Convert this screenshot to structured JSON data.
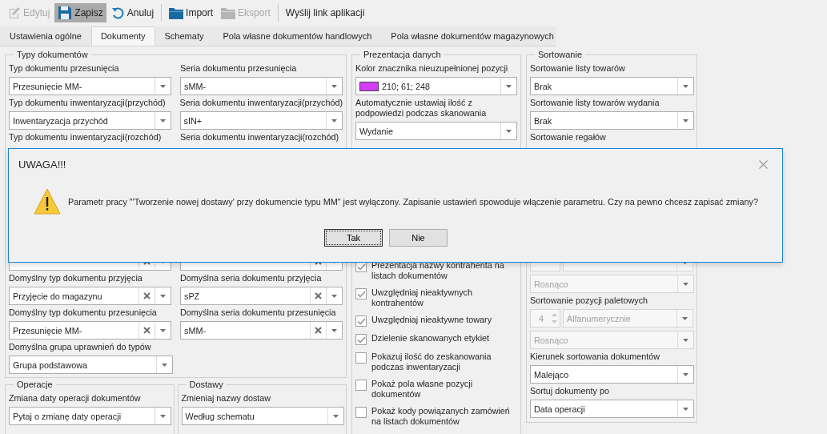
{
  "toolbar": [
    {
      "kind": "button",
      "label": "Edytuj",
      "disabled": true,
      "pressed": false
    },
    {
      "kind": "button",
      "label": "Zapisz",
      "disabled": false,
      "pressed": true
    },
    {
      "kind": "button",
      "label": "Anuluj",
      "disabled": false,
      "pressed": false
    },
    {
      "kind": "separator"
    },
    {
      "kind": "button",
      "label": "Import",
      "disabled": false,
      "pressed": false
    },
    {
      "kind": "button",
      "label": "Eksport",
      "disabled": true,
      "pressed": false
    },
    {
      "kind": "separator"
    },
    {
      "kind": "button",
      "label": "Wyślij link aplikacji",
      "disabled": false,
      "pressed": false
    }
  ],
  "tabs": [
    {
      "label": "Ustawienia ogólne",
      "selected": false
    },
    {
      "label": "Dokumenty",
      "selected": true
    },
    {
      "label": "Schematy",
      "selected": false
    },
    {
      "label": "Pola własne dokumentów handlowych",
      "selected": false
    },
    {
      "label": "Pola własne dokumentów magazynowych",
      "selected": false
    }
  ],
  "document_types": {
    "title": "Typy dokumentów",
    "rows_top": [
      [
        {
          "label": "Typ dokumentu przesunięcia",
          "value": "Przesunięcie MM-",
          "clearable": false
        },
        {
          "label": "Seria dokumentu przesunięcia",
          "value": "sMM-",
          "clearable": false
        }
      ],
      [
        {
          "label": "Typ dokumentu inwentaryzacji(przychód)",
          "value": "Inwentaryzacja przychód",
          "clearable": false
        },
        {
          "label": "Seria dokumentu inwentaryzacji(przychód)",
          "value": "sIN+",
          "clearable": false
        }
      ],
      [
        {
          "label": "Typ dokumentu inwentaryzacji(rozchód)"
        },
        {
          "label": "Seria dokumentu inwentaryzacji(rozchód)"
        }
      ]
    ],
    "rows_bottom": [
      [
        {
          "clearable": true
        },
        {
          "clearable": true
        }
      ],
      [
        {
          "label": "Domyślny typ dokumentu przyjęcia",
          "value": "Przyjęcie do magazynu",
          "clearable": true
        },
        {
          "label": "Domyślna seria dokumentu przyjęcia",
          "value": "sPZ",
          "clearable": true
        }
      ],
      [
        {
          "label": "Domyślny typ dokumentu przesunięcia",
          "value": "Przesunięcie MM-",
          "clearable": true
        },
        {
          "label": "Domyślna seria dokumentu przesunięcia",
          "value": "sMM-",
          "clearable": true
        }
      ],
      [
        {
          "label": "Domyślna grupa uprawnień do typów",
          "value": "Grupa podstawowa",
          "clearable": false
        }
      ]
    ]
  },
  "operations": {
    "title": "Operacje",
    "label": "Zmiana daty operacji dokumentów",
    "value": "Pytaj o zmianę daty operacji"
  },
  "deliveries": {
    "title": "Dostawy",
    "label": "Zmieniaj nazwy dostaw",
    "value": "Według schematu"
  },
  "data_presentation": {
    "title": "Prezentacja danych",
    "marker_color": {
      "label": "Kolor znacznika nieuzupełnionej pozycji",
      "color": "#d23df8",
      "value": "210; 61; 248"
    },
    "auto_quantity": {
      "label": "Automatycznie ustawiaj ilość z podpowiedzi podczas skanowania",
      "value": "Wydanie"
    },
    "checkboxes": [
      {
        "label": "Prezentacja nazwy kontrahenta na listach dokumentów",
        "checked": true
      },
      {
        "label": "Uwzględniaj nieaktywnych kontrahentów",
        "checked": true
      },
      {
        "label": "Uwzględniaj nieaktywne towary",
        "checked": true
      },
      {
        "label": "Dzielenie skanowanych etykiet",
        "checked": true
      },
      {
        "label": "Pokazuj ilość do zeskanowania podczas inwentaryzacji",
        "checked": false
      },
      {
        "label": "Pokaż pola własne pozycji dokumentów",
        "checked": false
      },
      {
        "label": "Pokaż kody powiązanych zamówień na listach dokumentów",
        "checked": false
      }
    ]
  },
  "sorting": {
    "title": "Sortowanie",
    "items_top": [
      {
        "kind": "select",
        "label": "Sortowanie listy towarów",
        "value": "Brak",
        "disabled": false
      },
      {
        "kind": "select",
        "label": "Sortowanie listy towarów wydania",
        "value": "Brak",
        "disabled": false
      },
      {
        "kind": "label",
        "label": "Sortowanie regałów"
      }
    ],
    "items_bottom": [
      {
        "kind": "spin",
        "disabled": true
      },
      {
        "kind": "select",
        "value": "Rosnąco",
        "disabled": true
      },
      {
        "kind": "label",
        "label": "Sortowanie pozycji paletowych"
      },
      {
        "kind": "spin",
        "number": "4",
        "value": "Alfanumerycznie",
        "disabled": true
      },
      {
        "kind": "select",
        "value": "Rosnąco",
        "disabled": true
      },
      {
        "kind": "select",
        "label": "Kierunek sortowania dokumentów",
        "value": "Malejąco",
        "disabled": false
      },
      {
        "kind": "select",
        "label": "Sortuj dokumenty po",
        "value": "Data operacji",
        "disabled": false
      }
    ]
  },
  "dialog": {
    "title": "UWAGA!!!",
    "message": "Parametr pracy \"'Tworzenie nowej dostawy' przy dokumencie typu MM\" jest wyłączony. Zapisanie ustawień spowoduje włączenie parametru. Czy na pewno chcesz zapisać zmiany?",
    "buttons": [
      {
        "label": "Tak",
        "focused": true
      },
      {
        "label": "Nie",
        "focused": false
      }
    ]
  }
}
